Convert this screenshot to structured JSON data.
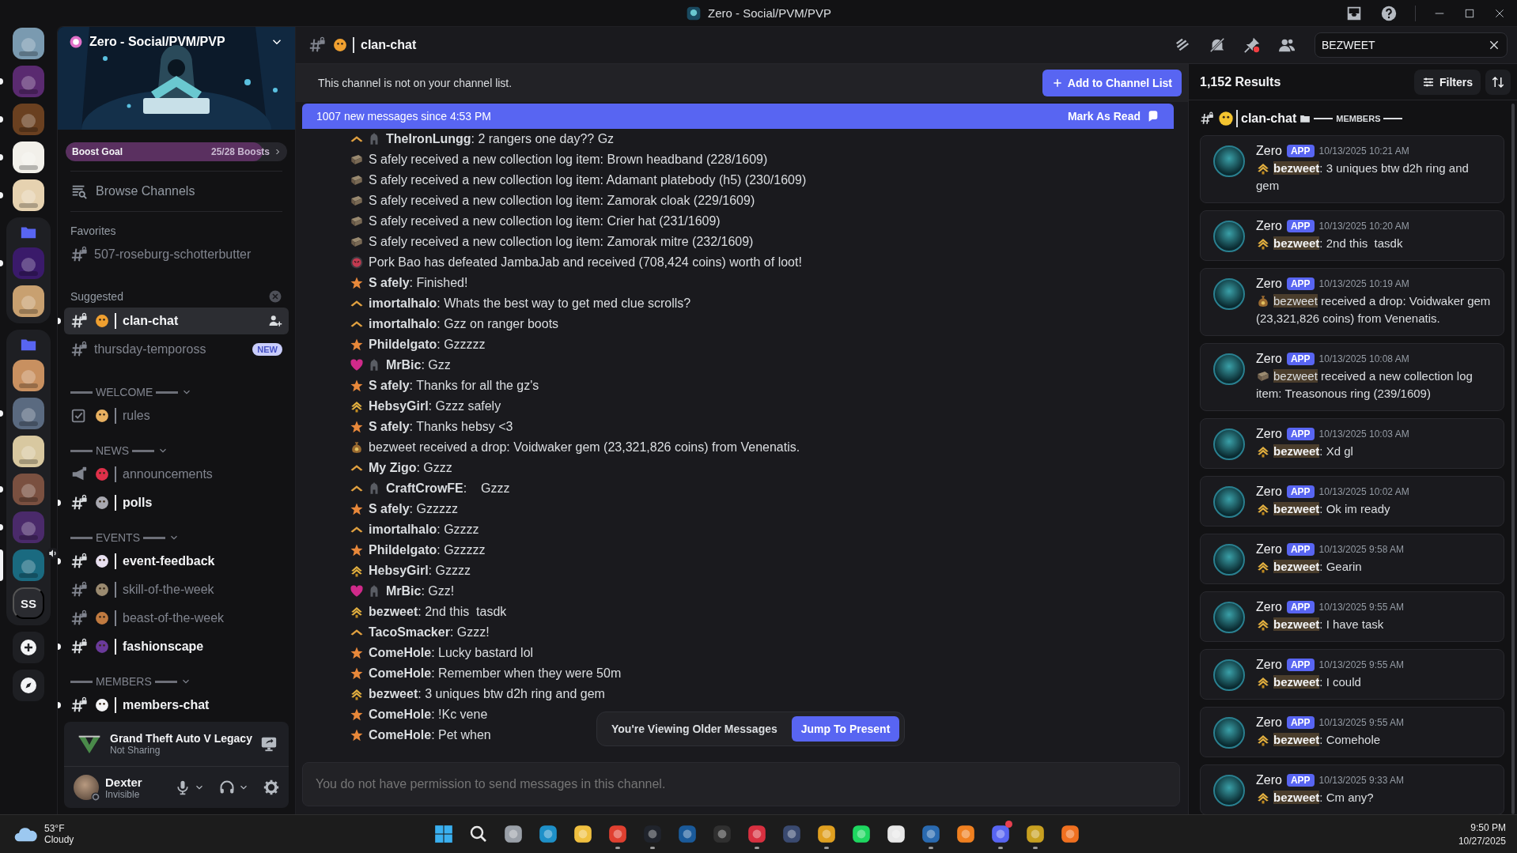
{
  "title_bar": {
    "title": "Zero - Social/PVM/PVP"
  },
  "server_rail": [
    {
      "kind": "server",
      "color": "#7a9ab0",
      "unread": false,
      "selected": false,
      "voice": false
    },
    {
      "kind": "server",
      "color": "#5a2a70",
      "unread": true,
      "selected": false,
      "voice": false
    },
    {
      "kind": "server",
      "color": "#6a4020",
      "unread": true,
      "selected": false,
      "voice": false
    },
    {
      "kind": "server",
      "color": "#f2f0ea",
      "unread": true,
      "selected": false,
      "voice": false
    },
    {
      "kind": "server",
      "color": "#e6d2b0",
      "unread": true,
      "selected": false,
      "voice": false
    },
    {
      "kind": "folder",
      "children": [
        {
          "kind": "server",
          "color": "#3a1a6a",
          "unread": true,
          "selected": false,
          "voice": false
        },
        {
          "kind": "server",
          "color": "#c8a070",
          "unread": false,
          "selected": false,
          "voice": false
        }
      ]
    },
    {
      "kind": "folder",
      "children": [
        {
          "kind": "server",
          "color": "#c89060",
          "unread": false,
          "selected": false,
          "voice": false
        },
        {
          "kind": "server",
          "color": "#5a6a80",
          "unread": true,
          "selected": false,
          "voice": false
        },
        {
          "kind": "server",
          "color": "#d8c8a0",
          "unread": false,
          "selected": false,
          "voice": false
        },
        {
          "kind": "server",
          "color": "#7a5040",
          "unread": true,
          "selected": false,
          "voice": false
        },
        {
          "kind": "server",
          "color": "#4a2a6a",
          "unread": true,
          "selected": false,
          "voice": false
        },
        {
          "kind": "server",
          "color": "#1a6a80",
          "unread": false,
          "selected": true,
          "voice": true
        },
        {
          "kind": "text",
          "label": "SS",
          "unread": false,
          "selected": false
        }
      ]
    },
    {
      "kind": "add"
    },
    {
      "kind": "discover"
    }
  ],
  "server": {
    "name": "Zero - Social/PVM/PVP",
    "boost": {
      "label": "Boost Goal",
      "count": "25/28 Boosts",
      "level": 0.89
    },
    "browse": "Browse Channels"
  },
  "channel_sections": [
    {
      "kind": "plain",
      "title": "Favorites",
      "closable": false,
      "channels": [
        {
          "kind": "text",
          "name": "507-roseburg-schotterbutter",
          "unread": false,
          "selected": false
        }
      ]
    },
    {
      "kind": "plain",
      "title": "Suggested",
      "closable": true,
      "channels": [
        {
          "kind": "text",
          "name": "clan-chat",
          "color": "#f0a030",
          "unread": true,
          "selected": true,
          "invite": true
        },
        {
          "kind": "text",
          "name": "thursday-tempoross",
          "unread": false,
          "selected": false,
          "badge": "NEW"
        }
      ]
    },
    {
      "kind": "category",
      "title": "WELCOME",
      "channels": [
        {
          "kind": "rules",
          "name": "rules",
          "color": "#e8b060",
          "unread": false,
          "selected": false
        }
      ]
    },
    {
      "kind": "category",
      "title": "NEWS",
      "channels": [
        {
          "kind": "announcement",
          "name": "announcements",
          "color": "#e0304a",
          "unread": false,
          "selected": false
        },
        {
          "kind": "text",
          "name": "polls",
          "color": "#a8a8b0",
          "unread": true,
          "selected": false
        }
      ]
    },
    {
      "kind": "category",
      "title": "EVENTS",
      "channels": [
        {
          "kind": "text",
          "name": "event-feedback",
          "color": "#e8e0f0",
          "unread": true,
          "selected": false
        },
        {
          "kind": "text",
          "name": "skill-of-the-week",
          "color": "#9a8a70",
          "unread": false,
          "selected": false
        },
        {
          "kind": "text",
          "name": "beast-of-the-week",
          "color": "#c07a40",
          "unread": false,
          "selected": false
        },
        {
          "kind": "text",
          "name": "fashionscape",
          "color": "#6a3a9a",
          "unread": true,
          "selected": false
        }
      ]
    },
    {
      "kind": "category",
      "title": "MEMBERS",
      "channels": [
        {
          "kind": "text",
          "name": "members-chat",
          "color": "#f4f4f6",
          "unread": true,
          "selected": false
        }
      ]
    }
  ],
  "activity": {
    "game": "Grand Theft Auto V Legacy",
    "status": "Not Sharing"
  },
  "user": {
    "name": "Dexter",
    "status": "Invisible"
  },
  "channel_header": {
    "name": "clan-chat",
    "color": "#f0a030"
  },
  "notice": {
    "text": "This channel is not on your channel list.",
    "button": "Add to Channel List"
  },
  "new_messages": {
    "text": "1007 new messages since 4:53 PM",
    "button": "Mark As Read"
  },
  "messages": [
    {
      "kind": "chevron",
      "helmet": true,
      "text": "**TheIronLungg**: 2 rangers one day?? Gz"
    },
    {
      "kind": "book",
      "helmet": false,
      "text": "S afely received a new collection log item: Brown headband (228/1609)"
    },
    {
      "kind": "book",
      "helmet": false,
      "text": "S afely received a new collection log item: Adamant platebody (h5) (230/1609)"
    },
    {
      "kind": "book",
      "helmet": false,
      "text": "S afely received a new collection log item: Zamorak cloak (229/1609)"
    },
    {
      "kind": "book",
      "helmet": false,
      "text": "S afely received a new collection log item: Crier hat (231/1609)"
    },
    {
      "kind": "book",
      "helmet": false,
      "text": "S afely received a new collection log item: Zamorak mitre (232/1609)"
    },
    {
      "kind": "skull",
      "helmet": false,
      "text": "Pork Bao has defeated JambaJab and received (708,424 coins) worth of loot!"
    },
    {
      "kind": "star",
      "helmet": false,
      "text": "**S afely**: Finished!"
    },
    {
      "kind": "chevron",
      "helmet": false,
      "text": "**imortalhalo**: Whats the best way to get med clue scrolls?"
    },
    {
      "kind": "chevron",
      "helmet": false,
      "text": "**imortalhalo**: Gzz on ranger boots"
    },
    {
      "kind": "star",
      "helmet": false,
      "text": "**Phildelgato**: Gzzzzz"
    },
    {
      "kind": "heart",
      "helmet": true,
      "text": "**MrBic**: Gzz"
    },
    {
      "kind": "star",
      "helmet": false,
      "text": "**S afely**: Thanks for all the gz's"
    },
    {
      "kind": "wings",
      "helmet": false,
      "text": "**HebsyGirl**: Gzzz safely"
    },
    {
      "kind": "star",
      "helmet": false,
      "text": "**S afely**: Thanks hebsy <3"
    },
    {
      "kind": "bag",
      "helmet": false,
      "text": "bezweet received a drop: Voidwaker gem (23,321,826 coins) from Venenatis."
    },
    {
      "kind": "chevron",
      "helmet": false,
      "text": "**My Zigo**: Gzzz"
    },
    {
      "kind": "chevron",
      "helmet": true,
      "text": "**CraftCrowFE**:    Gzzz"
    },
    {
      "kind": "star",
      "helmet": false,
      "text": "**S afely**: Gzzzzz"
    },
    {
      "kind": "chevron",
      "helmet": false,
      "text": "**imortalhalo**: Gzzzz"
    },
    {
      "kind": "star",
      "helmet": false,
      "text": "**Phildelgato**: Gzzzzz"
    },
    {
      "kind": "wings",
      "helmet": false,
      "text": "**HebsyGirl**: Gzzzz"
    },
    {
      "kind": "heart",
      "helmet": true,
      "text": "**MrBic**: Gzz!"
    },
    {
      "kind": "wings",
      "helmet": false,
      "text": "**bezweet**: 2nd this  tasdk"
    },
    {
      "kind": "chevron",
      "helmet": false,
      "text": "**TacoSmacker**: Gzzz!"
    },
    {
      "kind": "star",
      "helmet": false,
      "text": "**ComeHole**: Lucky bastard lol"
    },
    {
      "kind": "star",
      "helmet": false,
      "text": "**ComeHole**: Remember when they were 50m"
    },
    {
      "kind": "wings",
      "helmet": false,
      "text": "**bezweet**: 3 uniques btw d2h ring and gem"
    },
    {
      "kind": "star",
      "helmet": false,
      "text": "**ComeHole**: !Kc vene"
    },
    {
      "kind": "star",
      "helmet": false,
      "text": "**ComeHole**: Pet when"
    }
  ],
  "older_banner": {
    "text": "You're Viewing Older Messages",
    "button": "Jump To Present"
  },
  "composer": {
    "placeholder": "You do not have permission to send messages in this channel."
  },
  "search": {
    "value": "BEZWEET"
  },
  "results": {
    "count": "1,152 Results",
    "filters": "Filters",
    "channel": {
      "name": "clan-chat",
      "color": "#f4c430"
    },
    "category": "MEMBERS",
    "items": [
      {
        "author": "Zero",
        "tag": "APP",
        "time": "10/13/2025 10:21 AM",
        "kind": "wings",
        "match": "bezweet",
        "match_bold": true,
        "text": ": 3 uniques btw d2h ring and gem"
      },
      {
        "author": "Zero",
        "tag": "APP",
        "time": "10/13/2025 10:20 AM",
        "kind": "wings",
        "match": "bezweet",
        "match_bold": true,
        "text": ": 2nd this  tasdk"
      },
      {
        "author": "Zero",
        "tag": "APP",
        "time": "10/13/2025 10:19 AM",
        "kind": "bag",
        "match": "bezweet",
        "match_bold": false,
        "text": " received a drop: Voidwaker gem (23,321,826 coins) from Venenatis."
      },
      {
        "author": "Zero",
        "tag": "APP",
        "time": "10/13/2025 10:08 AM",
        "kind": "book",
        "match": "bezweet",
        "match_bold": false,
        "text": " received a new collection log item: Treasonous ring (239/1609)"
      },
      {
        "author": "Zero",
        "tag": "APP",
        "time": "10/13/2025 10:03 AM",
        "kind": "wings",
        "match": "bezweet",
        "match_bold": true,
        "text": ": Xd gl"
      },
      {
        "author": "Zero",
        "tag": "APP",
        "time": "10/13/2025 10:02 AM",
        "kind": "wings",
        "match": "bezweet",
        "match_bold": true,
        "text": ": Ok im ready"
      },
      {
        "author": "Zero",
        "tag": "APP",
        "time": "10/13/2025 9:58 AM",
        "kind": "wings",
        "match": "bezweet",
        "match_bold": true,
        "text": ": Gearin"
      },
      {
        "author": "Zero",
        "tag": "APP",
        "time": "10/13/2025 9:55 AM",
        "kind": "wings",
        "match": "bezweet",
        "match_bold": true,
        "text": ": I have task"
      },
      {
        "author": "Zero",
        "tag": "APP",
        "time": "10/13/2025 9:55 AM",
        "kind": "wings",
        "match": "bezweet",
        "match_bold": true,
        "text": ": I could"
      },
      {
        "author": "Zero",
        "tag": "APP",
        "time": "10/13/2025 9:55 AM",
        "kind": "wings",
        "match": "bezweet",
        "match_bold": true,
        "text": ": Comehole"
      },
      {
        "author": "Zero",
        "tag": "APP",
        "time": "10/13/2025 9:33 AM",
        "kind": "wings",
        "match": "bezweet",
        "match_bold": true,
        "text": ": Cm any?"
      }
    ]
  },
  "taskbar": {
    "weather": {
      "temp": "53°F",
      "condition": "Cloudy"
    },
    "apps": [
      {
        "kind": "start",
        "running": false,
        "notification": false
      },
      {
        "kind": "search",
        "running": false,
        "notification": false
      },
      {
        "kind": "app",
        "color": "#9aa0a8",
        "running": false,
        "notification": false
      },
      {
        "kind": "app",
        "color": "#1e90c8",
        "running": false,
        "notification": false
      },
      {
        "kind": "app",
        "color": "#f0c040",
        "running": false,
        "notification": false
      },
      {
        "kind": "app",
        "color": "#e04030",
        "running": true,
        "notification": false
      },
      {
        "kind": "app",
        "color": "#20242c",
        "running": true,
        "notification": false
      },
      {
        "kind": "app",
        "color": "#1a5a9a",
        "running": false,
        "notification": false
      },
      {
        "kind": "app",
        "color": "#303030",
        "running": false,
        "notification": false
      },
      {
        "kind": "app",
        "color": "#d83040",
        "running": true,
        "notification": false
      },
      {
        "kind": "app",
        "color": "#3a4a70",
        "running": false,
        "notification": false
      },
      {
        "kind": "app",
        "color": "#e0a020",
        "running": true,
        "notification": false
      },
      {
        "kind": "app",
        "color": "#1ed760",
        "running": false,
        "notification": false
      },
      {
        "kind": "app",
        "color": "#e8e8e8",
        "running": false,
        "notification": false
      },
      {
        "kind": "app",
        "color": "#2a6ab0",
        "running": true,
        "notification": false
      },
      {
        "kind": "app",
        "color": "#f08020",
        "running": false,
        "notification": false
      },
      {
        "kind": "app",
        "color": "#5865f2",
        "running": true,
        "notification": true
      },
      {
        "kind": "app",
        "color": "#c8a020",
        "running": true,
        "notification": false
      },
      {
        "kind": "app",
        "color": "#f07020",
        "running": false,
        "notification": false
      }
    ],
    "time": "9:50 PM",
    "date": "10/27/2025"
  }
}
